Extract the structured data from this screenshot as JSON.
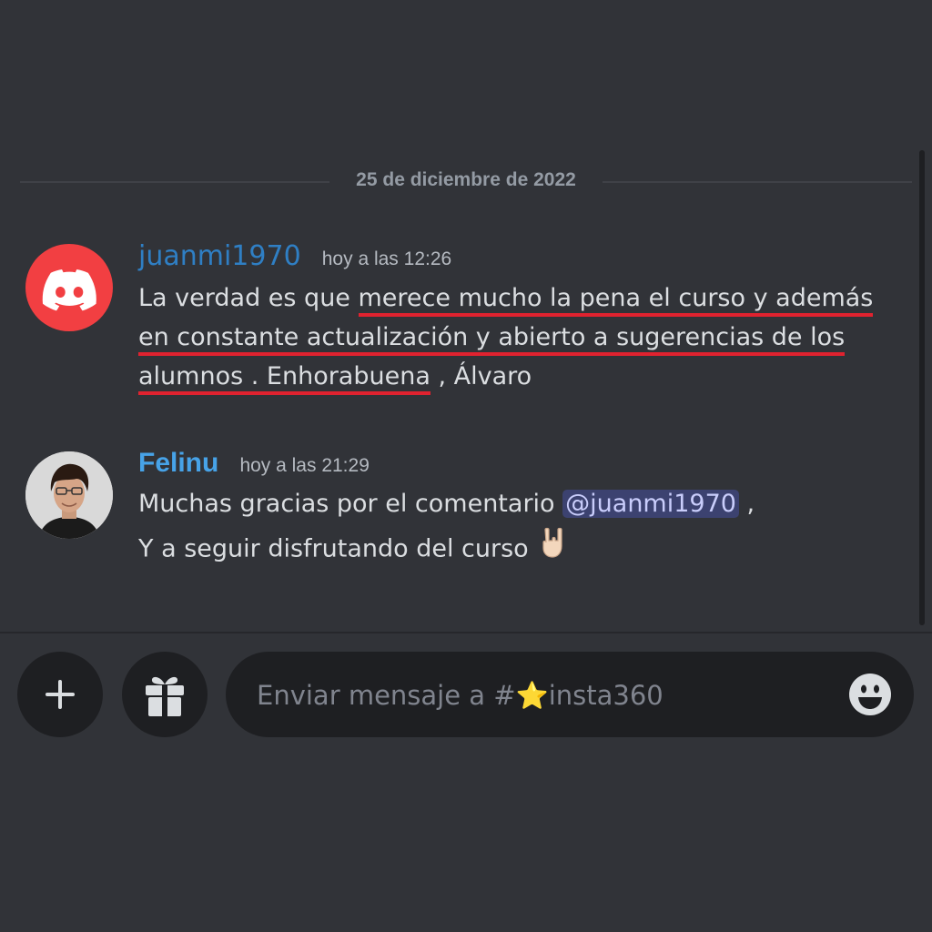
{
  "channel": {
    "date_divider": "25 de diciembre de 2022"
  },
  "messages": [
    {
      "username": "juanmi1970",
      "timestamp": "hoy a las 12:26",
      "avatar_icon": "discord-logo-icon",
      "lines": [
        {
          "plain": "La verdad es que ",
          "underlined": "merece mucho la pena el curso y además",
          "after": ""
        },
        {
          "plain": "",
          "underlined": "en constante actualización y  abierto a sugerencias de los",
          "after": ""
        },
        {
          "plain": "",
          "underlined": "alumnos . Enhorabuena",
          "after": " , Álvaro"
        }
      ]
    },
    {
      "username": "Felinu",
      "timestamp": "hoy a las 21:29",
      "avatar_icon": "user-photo-avatar",
      "line1_text": "Muchas gracias por el comentario ",
      "mention": "@juanmi1970",
      "line1_after": " ,",
      "line2_text": " Y a seguir disfrutando del curso ",
      "emoji": "rock-on-hand-icon"
    }
  ],
  "composer": {
    "placeholder": "Enviar mensaje a #⭐insta360",
    "plus_icon": "plus-icon",
    "gift_icon": "gift-icon",
    "emoji_icon": "smiley-face-icon"
  },
  "colors": {
    "background": "#313338",
    "underline": "#e0222f",
    "discord_red": "#f23f42",
    "mention_bg": "#3c4270"
  }
}
